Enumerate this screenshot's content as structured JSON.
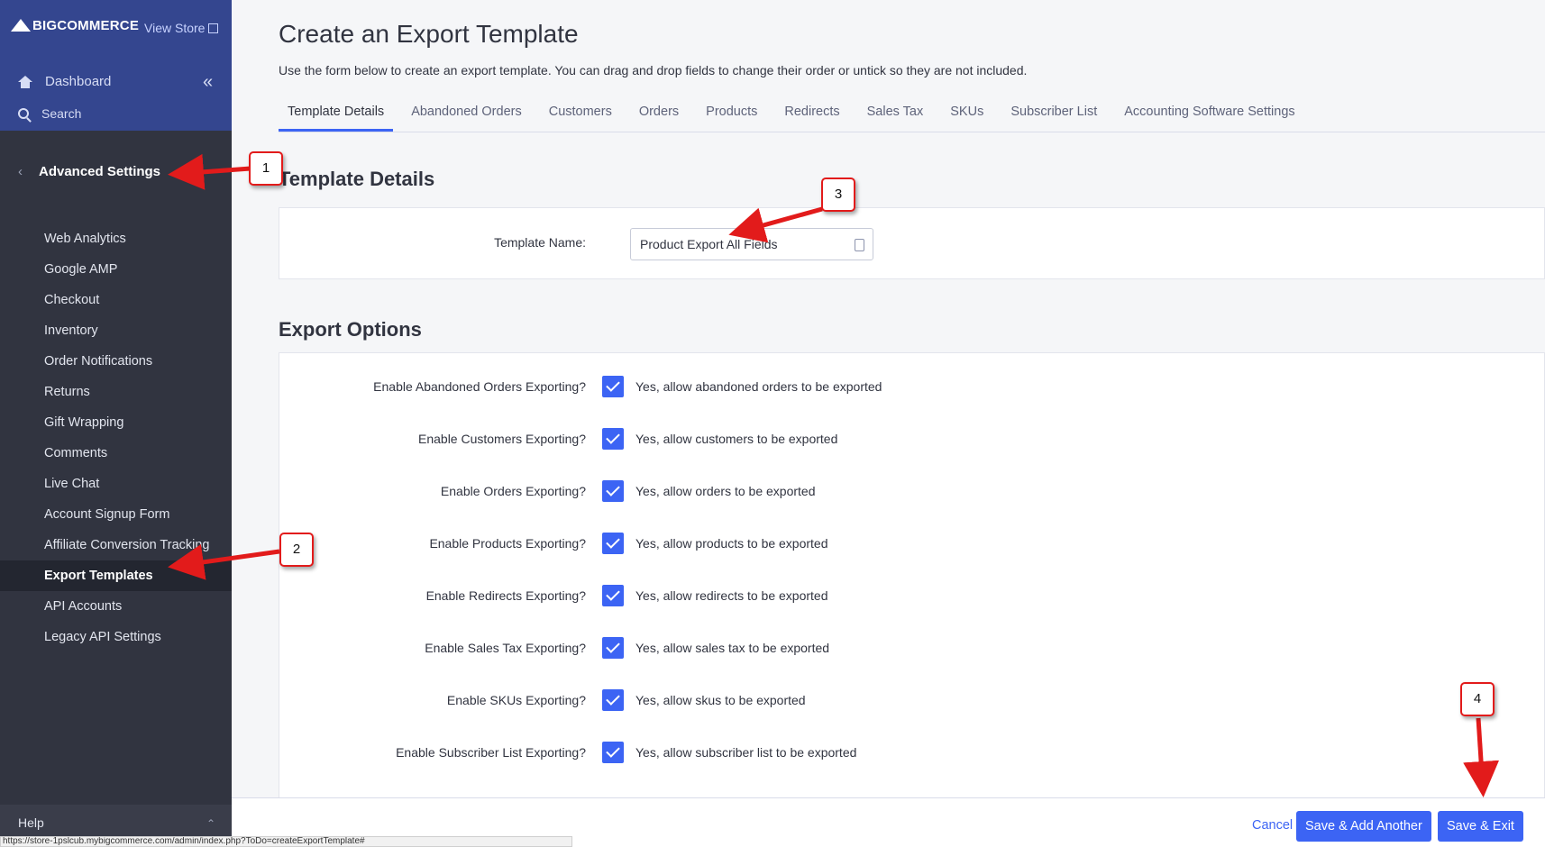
{
  "brand": {
    "logo_text": "BIGCOMMERCE",
    "view_store": "View Store"
  },
  "nav": {
    "dashboard": "Dashboard",
    "search": "Search"
  },
  "sidebar": {
    "section_title": "Advanced Settings",
    "items": [
      {
        "label": "Web Analytics"
      },
      {
        "label": "Google AMP"
      },
      {
        "label": "Checkout"
      },
      {
        "label": "Inventory"
      },
      {
        "label": "Order Notifications"
      },
      {
        "label": "Returns"
      },
      {
        "label": "Gift Wrapping"
      },
      {
        "label": "Comments"
      },
      {
        "label": "Live Chat"
      },
      {
        "label": "Account Signup Form"
      },
      {
        "label": "Affiliate Conversion Tracking"
      },
      {
        "label": "Export Templates"
      },
      {
        "label": "API Accounts"
      },
      {
        "label": "Legacy API Settings"
      }
    ],
    "active_item": "Export Templates",
    "help": "Help"
  },
  "page": {
    "title": "Create an Export Template",
    "description": "Use the form below to create an export template. You can drag and drop fields to change their order or untick so they are not included."
  },
  "tabs": [
    {
      "label": "Template Details"
    },
    {
      "label": "Abandoned Orders"
    },
    {
      "label": "Customers"
    },
    {
      "label": "Orders"
    },
    {
      "label": "Products"
    },
    {
      "label": "Redirects"
    },
    {
      "label": "Sales Tax"
    },
    {
      "label": "SKUs"
    },
    {
      "label": "Subscriber List"
    },
    {
      "label": "Accounting Software Settings"
    }
  ],
  "template_details": {
    "heading": "Template Details",
    "name_label": "Template Name:",
    "name_value": "Product Export All Fields"
  },
  "export_options": {
    "heading": "Export Options",
    "rows": [
      {
        "label": "Enable Abandoned Orders Exporting?",
        "checkbox_label": "Yes, allow abandoned orders to be exported",
        "checked": true
      },
      {
        "label": "Enable Customers Exporting?",
        "checkbox_label": "Yes, allow customers to be exported",
        "checked": true
      },
      {
        "label": "Enable Orders Exporting?",
        "checkbox_label": "Yes, allow orders to be exported",
        "checked": true
      },
      {
        "label": "Enable Products Exporting?",
        "checkbox_label": "Yes, allow products to be exported",
        "checked": true
      },
      {
        "label": "Enable Redirects Exporting?",
        "checkbox_label": "Yes, allow redirects to be exported",
        "checked": true
      },
      {
        "label": "Enable Sales Tax Exporting?",
        "checkbox_label": "Yes, allow sales tax to be exported",
        "checked": true
      },
      {
        "label": "Enable SKUs Exporting?",
        "checkbox_label": "Yes, allow skus to be exported",
        "checked": true
      },
      {
        "label": "Enable Subscriber List Exporting?",
        "checkbox_label": "Yes, allow subscriber list to be exported",
        "checked": true
      }
    ]
  },
  "footer": {
    "cancel": "Cancel",
    "save_add_another": "Save & Add Another",
    "save_exit": "Save & Exit"
  },
  "status_url": "https://store-1pslcub.mybigcommerce.com/admin/index.php?ToDo=createExportTemplate#",
  "annotations": [
    "1",
    "2",
    "3",
    "4"
  ],
  "colors": {
    "accent": "#3c64f4",
    "sidebar": "#313440",
    "annotation": "#e21b1b"
  }
}
